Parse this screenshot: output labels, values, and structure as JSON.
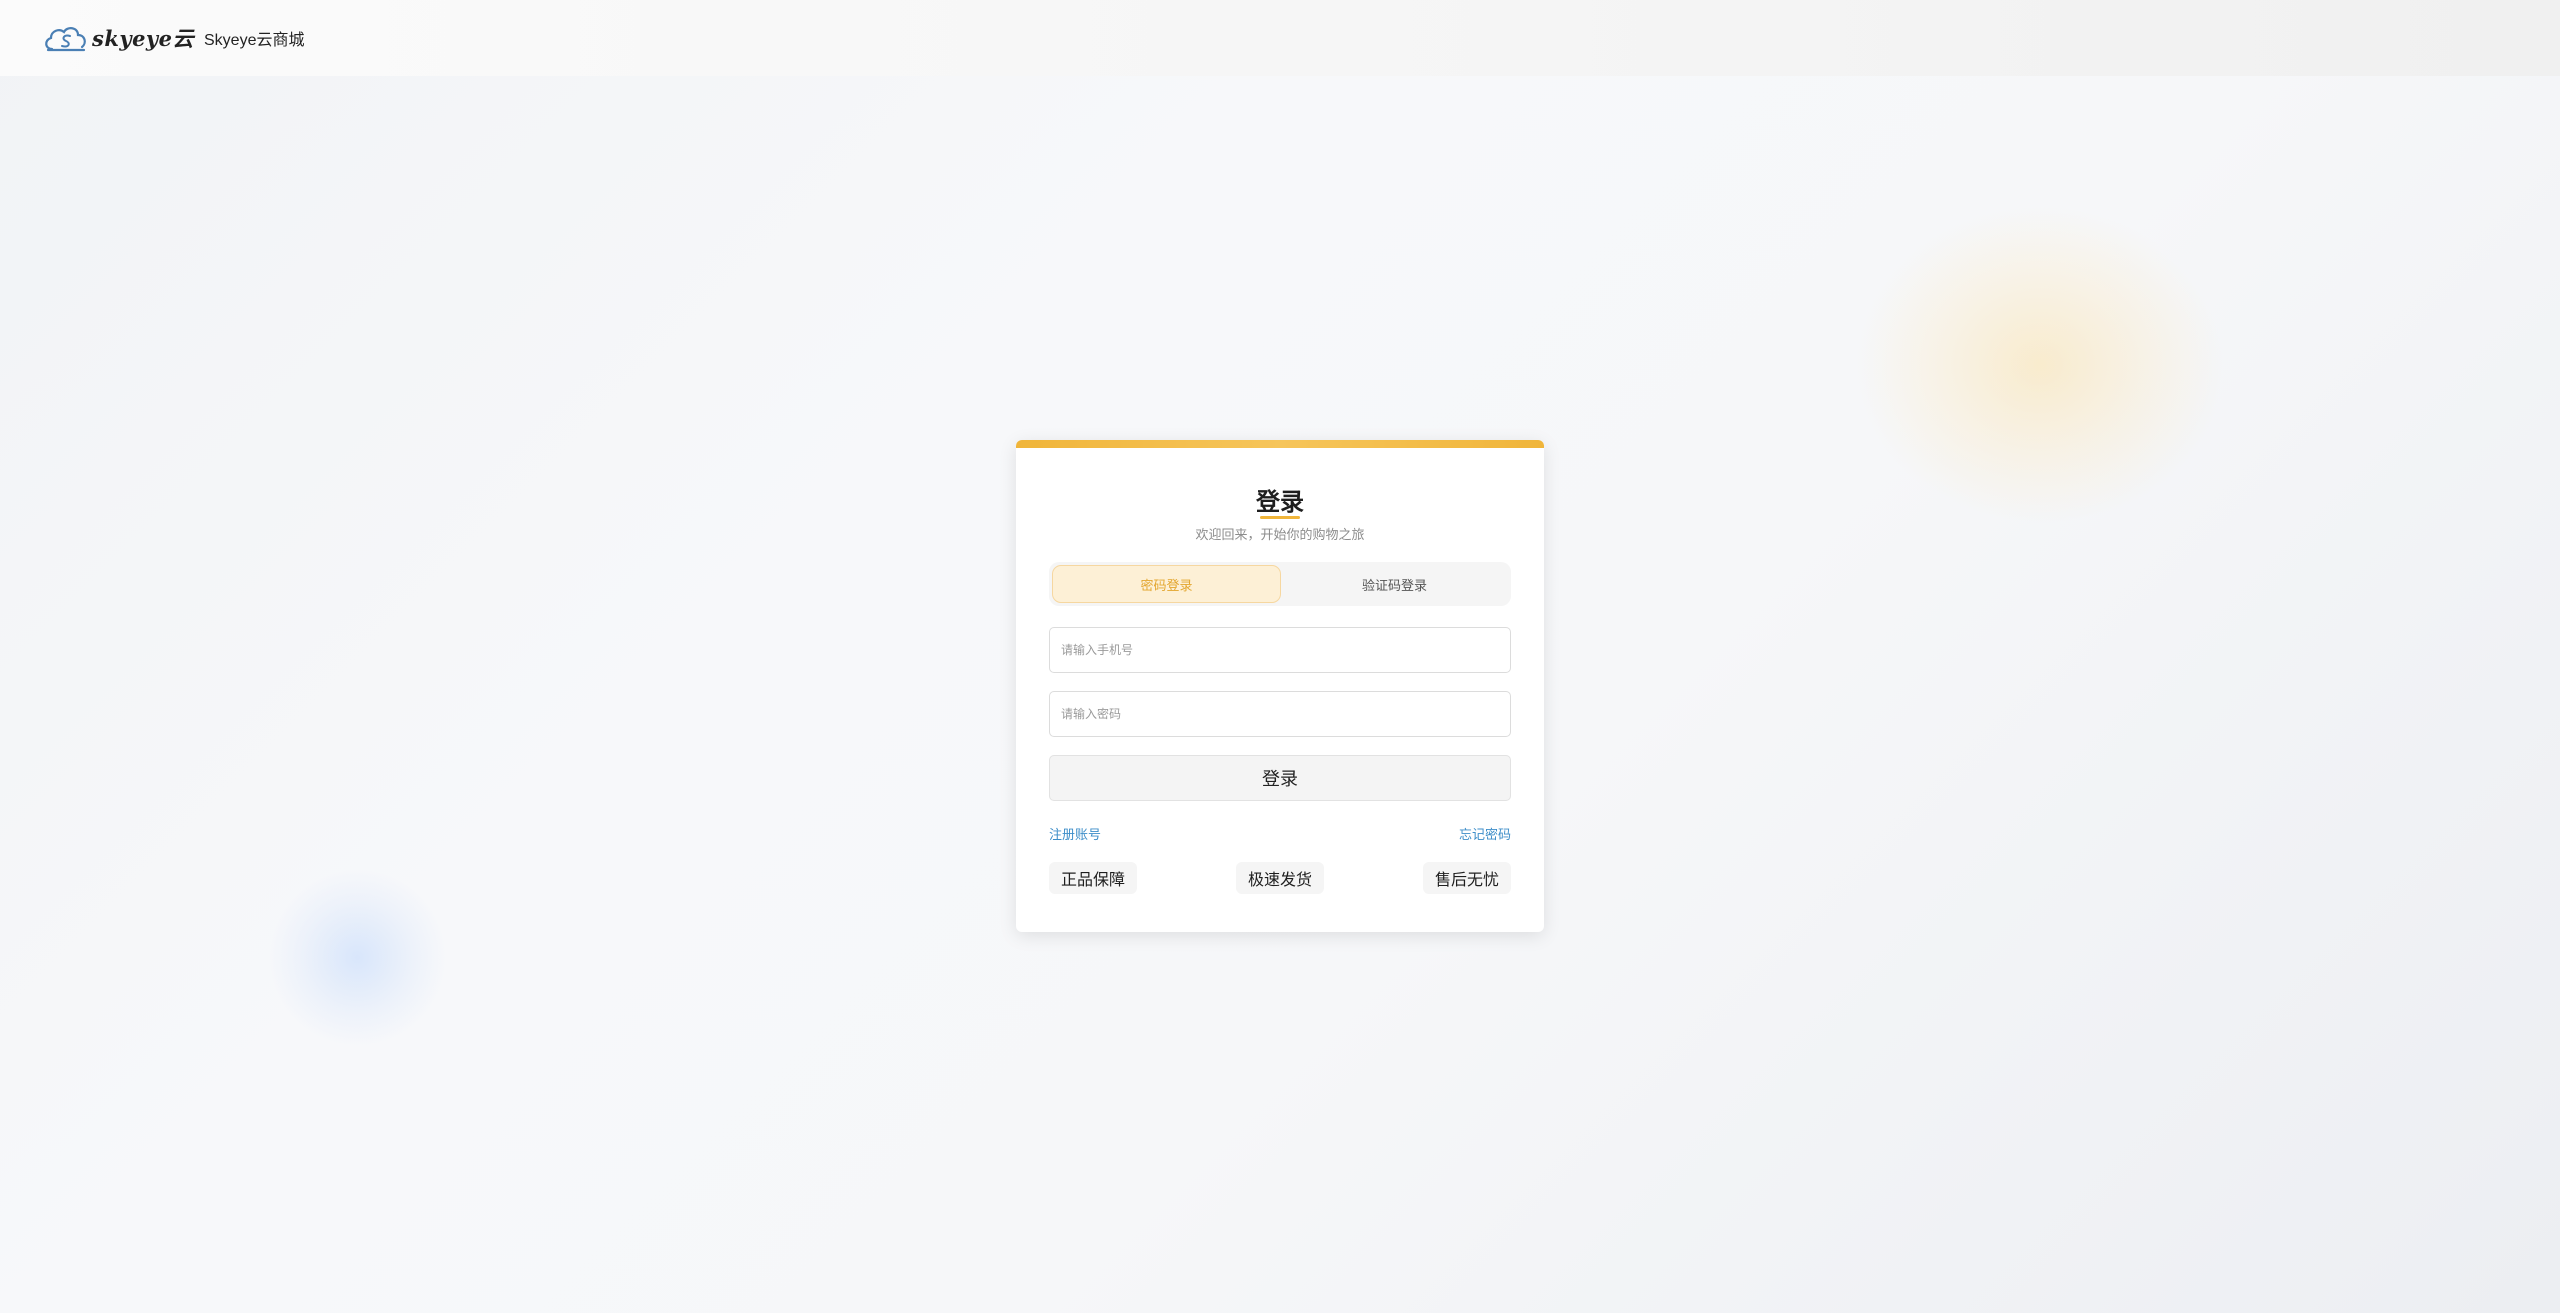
{
  "header": {
    "logo_text": "skyeye云",
    "brand_name": "Skyeye云商城",
    "logo_icon": "cloud-icon"
  },
  "login_card": {
    "title": "登录",
    "subtitle": "欢迎回来，开始你的购物之旅",
    "tabs": [
      {
        "label": "密码登录",
        "active": true
      },
      {
        "label": "验证码登录",
        "active": false
      }
    ],
    "phone_placeholder": "请输入手机号",
    "password_placeholder": "请输入密码",
    "submit_label": "登录",
    "register_link": "注册账号",
    "forgot_link": "忘记密码",
    "features": [
      "正品保障",
      "极速发货",
      "售后无忧"
    ]
  },
  "colors": {
    "accent": "#f0b53a",
    "link": "#3d8ec9",
    "active_tab_bg": "#fdf0d6"
  }
}
